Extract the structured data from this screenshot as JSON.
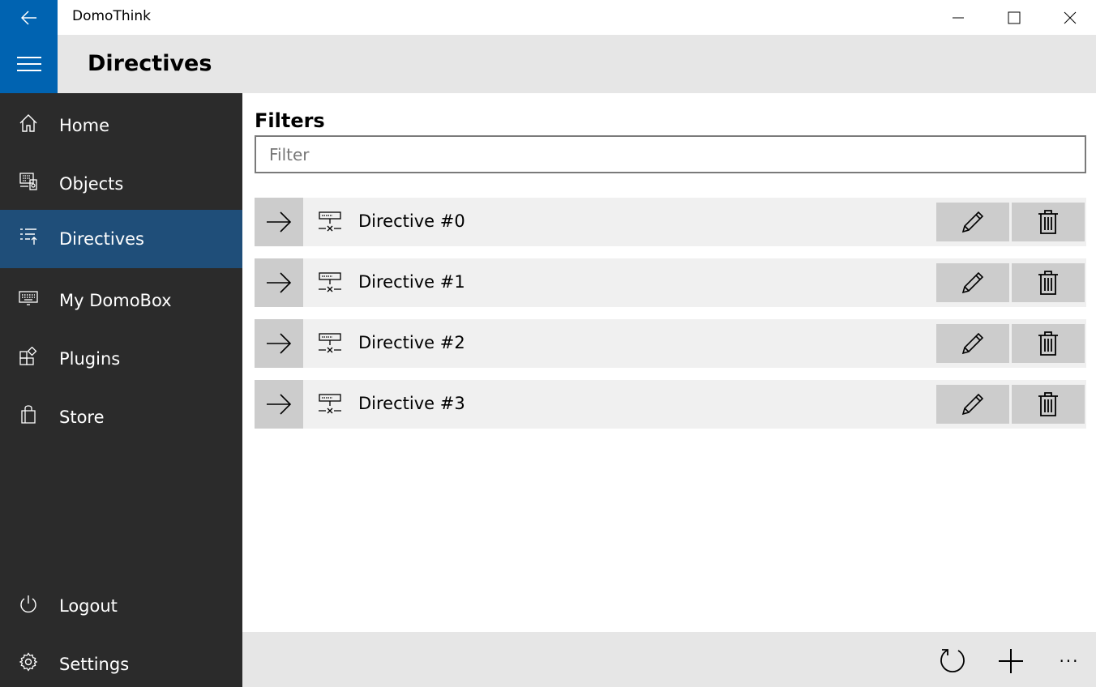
{
  "window": {
    "title": "DomoThink",
    "accent_color": "#0063b1"
  },
  "header": {
    "page_title": "Directives"
  },
  "sidebar": {
    "items": [
      {
        "label": "Home",
        "icon": "home-icon"
      },
      {
        "label": "Objects",
        "icon": "objects-icon"
      },
      {
        "label": "Directives",
        "icon": "directives-icon",
        "active": true
      },
      {
        "label": "My DomoBox",
        "icon": "keyboard-icon"
      },
      {
        "label": "Plugins",
        "icon": "plugins-icon"
      },
      {
        "label": "Store",
        "icon": "store-bag-icon"
      }
    ],
    "footer_items": [
      {
        "label": "Logout",
        "icon": "power-icon"
      },
      {
        "label": "Settings",
        "icon": "gear-icon"
      }
    ]
  },
  "main": {
    "filters_title": "Filters",
    "filter_placeholder": "Filter",
    "filter_value": "",
    "directives": [
      {
        "label": "Directive #0"
      },
      {
        "label": "Directive #1"
      },
      {
        "label": "Directive #2"
      },
      {
        "label": "Directive #3"
      }
    ]
  },
  "command_bar": {
    "buttons": [
      "refresh-icon",
      "add-icon",
      "more-icon"
    ],
    "more_label": "···"
  }
}
